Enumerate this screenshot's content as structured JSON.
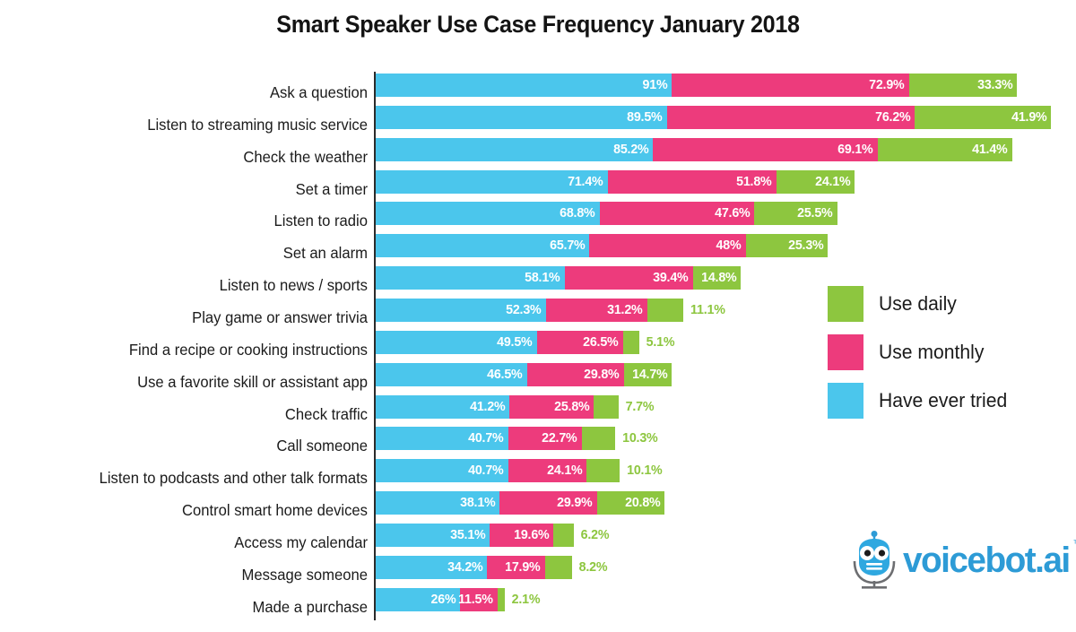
{
  "title": "Smart Speaker Use Case Frequency January 2018",
  "branding": {
    "logo_name": "voicebot-robot-mic-icon",
    "logo_text": "voicebot.ai",
    "trademark": "™"
  },
  "colors": {
    "have_ever_tried": "#4BC6EC",
    "use_monthly": "#ED3B7C",
    "use_daily": "#8DC63F",
    "axis": "#2b2b2b",
    "text": "#1b1b1b",
    "background": "#ffffff"
  },
  "legend": {
    "position": "right-middle",
    "items": [
      {
        "label": "Use daily",
        "color": "#8DC63F"
      },
      {
        "label": "Use monthly",
        "color": "#ED3B7C"
      },
      {
        "label": "Have ever tried",
        "color": "#4BC6EC"
      }
    ]
  },
  "chart_data": {
    "type": "bar",
    "orientation": "horizontal",
    "stacked": true,
    "title": "Smart Speaker Use Case Frequency January 2018",
    "xlabel": "",
    "ylabel": "",
    "grid": false,
    "axis_ticks_shown": false,
    "legend_entries": [
      "Use daily",
      "Use monthly",
      "Have ever tried"
    ],
    "categories": [
      "Ask a question",
      "Listen to streaming music service",
      "Check the weather",
      "Set a timer",
      "Listen to radio",
      "Set an alarm",
      "Listen to news / sports",
      "Play game or answer trivia",
      "Find a recipe or cooking instructions",
      "Use a favorite skill or assistant app",
      "Check traffic",
      "Call someone",
      "Listen to podcasts and other talk formats",
      "Control smart home devices",
      "Access my calendar",
      "Message someone",
      "Made a purchase"
    ],
    "series": [
      {
        "name": "Have ever tried",
        "color": "#4BC6EC",
        "values": [
          91,
          89.5,
          85.2,
          71.4,
          68.8,
          65.7,
          58.1,
          52.3,
          49.5,
          46.5,
          41.2,
          40.7,
          40.7,
          38.1,
          35.1,
          34.2,
          26
        ],
        "labels": [
          "91%",
          "89.5%",
          "85.2%",
          "71.4%",
          "68.8%",
          "65.7%",
          "58.1%",
          "52.3%",
          "49.5%",
          "46.5%",
          "41.2%",
          "40.7%",
          "40.7%",
          "38.1%",
          "35.1%",
          "34.2%",
          "26%"
        ]
      },
      {
        "name": "Use monthly",
        "color": "#ED3B7C",
        "values": [
          72.9,
          76.2,
          69.1,
          51.8,
          47.6,
          48,
          39.4,
          31.2,
          26.5,
          29.8,
          25.8,
          22.7,
          24.1,
          29.9,
          19.6,
          17.9,
          11.5
        ],
        "labels": [
          "72.9%",
          "76.2%",
          "69.1%",
          "51.8%",
          "47.6%",
          "48%",
          "39.4%",
          "31.2%",
          "26.5%",
          "29.8%",
          "25.8%",
          "22.7%",
          "24.1%",
          "29.9%",
          "19.6%",
          "17.9%",
          "11.5%"
        ]
      },
      {
        "name": "Use daily",
        "color": "#8DC63F",
        "values": [
          33.3,
          41.9,
          41.4,
          24.1,
          25.5,
          25.3,
          14.8,
          11.1,
          5.1,
          14.7,
          7.7,
          10.3,
          10.1,
          20.8,
          6.2,
          8.2,
          2.1
        ],
        "labels": [
          "33.3%",
          "41.9%",
          "41.4%",
          "24.1%",
          "25.5%",
          "25.3%",
          "14.8%",
          "11.1%",
          "5.1%",
          "14.7%",
          "7.7%",
          "10.3%",
          "10.1%",
          "20.8%",
          "6.2%",
          "8.2%",
          "2.1%"
        ]
      }
    ],
    "units": "percent"
  }
}
